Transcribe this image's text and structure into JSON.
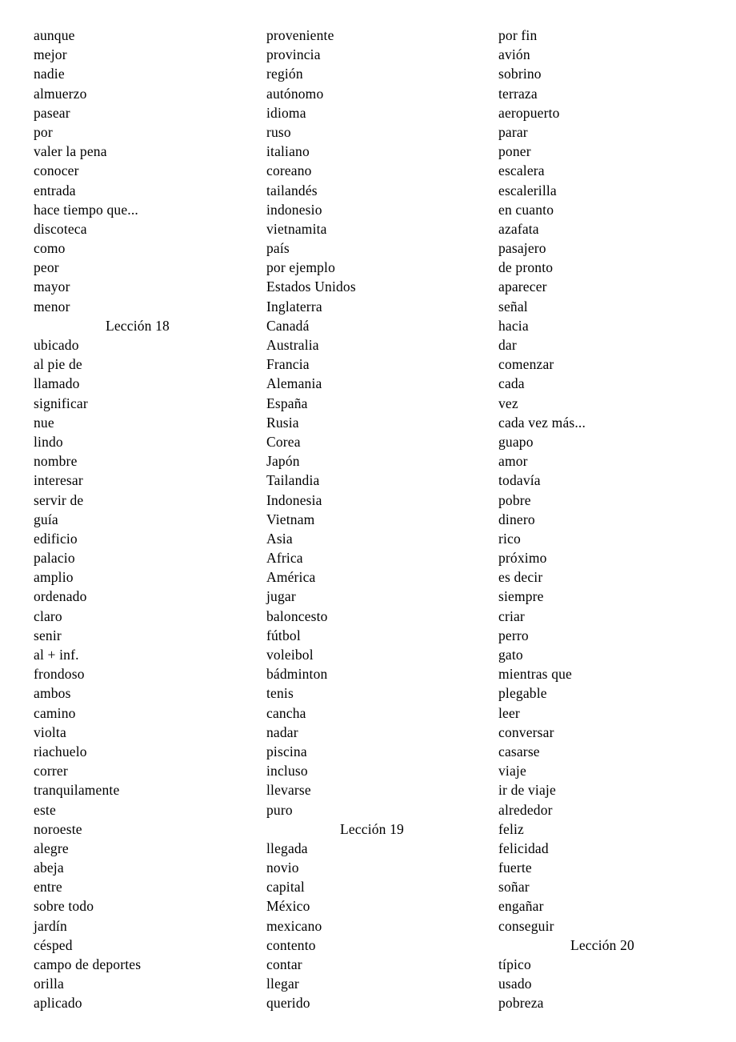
{
  "document": {
    "type": "vocabulary-word-list",
    "language": "Spanish",
    "columns": [
      {
        "id": "column-1",
        "lines": [
          {
            "kind": "entry",
            "text": "aunque"
          },
          {
            "kind": "entry",
            "text": "mejor"
          },
          {
            "kind": "entry",
            "text": "nadie"
          },
          {
            "kind": "entry",
            "text": "almuerzo"
          },
          {
            "kind": "entry",
            "text": "pasear"
          },
          {
            "kind": "entry",
            "text": "por"
          },
          {
            "kind": "entry",
            "text": "valer la pena"
          },
          {
            "kind": "entry",
            "text": "conocer"
          },
          {
            "kind": "entry",
            "text": "entrada"
          },
          {
            "kind": "entry",
            "text": "hace tiempo que..."
          },
          {
            "kind": "entry",
            "text": "discoteca"
          },
          {
            "kind": "entry",
            "text": "como"
          },
          {
            "kind": "entry",
            "text": "peor"
          },
          {
            "kind": "entry",
            "text": "mayor"
          },
          {
            "kind": "entry",
            "text": "menor"
          },
          {
            "kind": "heading",
            "text": "Lección 18"
          },
          {
            "kind": "entry",
            "text": "ubicado"
          },
          {
            "kind": "entry",
            "text": "al pie de"
          },
          {
            "kind": "entry",
            "text": "llamado"
          },
          {
            "kind": "entry",
            "text": "significar"
          },
          {
            "kind": "entry",
            "text": "nue"
          },
          {
            "kind": "entry",
            "text": "lindo"
          },
          {
            "kind": "entry",
            "text": "nombre"
          },
          {
            "kind": "entry",
            "text": "interesar"
          },
          {
            "kind": "entry",
            "text": "servir de"
          },
          {
            "kind": "entry",
            "text": "guía"
          },
          {
            "kind": "entry",
            "text": "edificio"
          },
          {
            "kind": "entry",
            "text": "palacio"
          },
          {
            "kind": "entry",
            "text": "amplio"
          },
          {
            "kind": "entry",
            "text": "ordenado"
          },
          {
            "kind": "entry",
            "text": "claro"
          },
          {
            "kind": "entry",
            "text": "senir"
          },
          {
            "kind": "entry",
            "text": "al + inf."
          },
          {
            "kind": "entry",
            "text": "frondoso"
          },
          {
            "kind": "entry",
            "text": "ambos"
          },
          {
            "kind": "entry",
            "text": "camino"
          },
          {
            "kind": "entry",
            "text": "violta"
          },
          {
            "kind": "entry",
            "text": "riachuelo"
          },
          {
            "kind": "entry",
            "text": "correr"
          },
          {
            "kind": "entry",
            "text": "tranquilamente"
          },
          {
            "kind": "entry",
            "text": "este"
          },
          {
            "kind": "entry",
            "text": "noroeste"
          },
          {
            "kind": "entry",
            "text": "alegre"
          },
          {
            "kind": "entry",
            "text": "abeja"
          },
          {
            "kind": "entry",
            "text": "entre"
          },
          {
            "kind": "entry",
            "text": "sobre todo"
          },
          {
            "kind": "entry",
            "text": "jardín"
          },
          {
            "kind": "entry",
            "text": "césped"
          },
          {
            "kind": "entry",
            "text": "campo de deportes"
          },
          {
            "kind": "entry",
            "text": "orilla"
          },
          {
            "kind": "entry",
            "text": "aplicado"
          }
        ]
      },
      {
        "id": "column-2",
        "lines": [
          {
            "kind": "entry",
            "text": "proveniente"
          },
          {
            "kind": "entry",
            "text": "provincia"
          },
          {
            "kind": "entry",
            "text": "región"
          },
          {
            "kind": "entry",
            "text": "autónomo"
          },
          {
            "kind": "entry",
            "text": "idioma"
          },
          {
            "kind": "entry",
            "text": "ruso"
          },
          {
            "kind": "entry",
            "text": "italiano"
          },
          {
            "kind": "entry",
            "text": "coreano"
          },
          {
            "kind": "entry",
            "text": "tailandés"
          },
          {
            "kind": "entry",
            "text": "indonesio"
          },
          {
            "kind": "entry",
            "text": "vietnamita"
          },
          {
            "kind": "entry",
            "text": "país"
          },
          {
            "kind": "entry",
            "text": "por ejemplo"
          },
          {
            "kind": "entry",
            "text": "Estados Unidos"
          },
          {
            "kind": "entry",
            "text": "Inglaterra"
          },
          {
            "kind": "entry",
            "text": "Canadá"
          },
          {
            "kind": "entry",
            "text": "Australia"
          },
          {
            "kind": "entry",
            "text": "Francia"
          },
          {
            "kind": "entry",
            "text": "Alemania"
          },
          {
            "kind": "entry",
            "text": "España"
          },
          {
            "kind": "entry",
            "text": "Rusia"
          },
          {
            "kind": "entry",
            "text": "Corea"
          },
          {
            "kind": "entry",
            "text": "Japón"
          },
          {
            "kind": "entry",
            "text": "Tailandia"
          },
          {
            "kind": "entry",
            "text": "Indonesia"
          },
          {
            "kind": "entry",
            "text": "Vietnam"
          },
          {
            "kind": "entry",
            "text": "Asia"
          },
          {
            "kind": "entry",
            "text": "Africa"
          },
          {
            "kind": "entry",
            "text": "América"
          },
          {
            "kind": "entry",
            "text": "jugar"
          },
          {
            "kind": "entry",
            "text": "baloncesto"
          },
          {
            "kind": "entry",
            "text": "fútbol"
          },
          {
            "kind": "entry",
            "text": "voleibol"
          },
          {
            "kind": "entry",
            "text": "bádminton"
          },
          {
            "kind": "entry",
            "text": "tenis"
          },
          {
            "kind": "entry",
            "text": "cancha"
          },
          {
            "kind": "entry",
            "text": "nadar"
          },
          {
            "kind": "entry",
            "text": "piscina"
          },
          {
            "kind": "entry",
            "text": "incluso"
          },
          {
            "kind": "entry",
            "text": "llevarse"
          },
          {
            "kind": "entry",
            "text": "puro"
          },
          {
            "kind": "heading",
            "text": "Lección 19"
          },
          {
            "kind": "entry",
            "text": "llegada"
          },
          {
            "kind": "entry",
            "text": "novio"
          },
          {
            "kind": "entry",
            "text": "capital"
          },
          {
            "kind": "entry",
            "text": "México"
          },
          {
            "kind": "entry",
            "text": "mexicano"
          },
          {
            "kind": "entry",
            "text": "contento"
          },
          {
            "kind": "entry",
            "text": "contar"
          },
          {
            "kind": "entry",
            "text": "llegar"
          },
          {
            "kind": "entry",
            "text": "querido"
          }
        ]
      },
      {
        "id": "column-3",
        "lines": [
          {
            "kind": "entry",
            "text": "por fin"
          },
          {
            "kind": "entry",
            "text": "avión"
          },
          {
            "kind": "entry",
            "text": "sobrino"
          },
          {
            "kind": "entry",
            "text": "terraza"
          },
          {
            "kind": "entry",
            "text": "aeropuerto"
          },
          {
            "kind": "entry",
            "text": "parar"
          },
          {
            "kind": "entry",
            "text": "poner"
          },
          {
            "kind": "entry",
            "text": "escalera"
          },
          {
            "kind": "entry",
            "text": "escalerilla"
          },
          {
            "kind": "entry",
            "text": "en cuanto"
          },
          {
            "kind": "entry",
            "text": "azafata"
          },
          {
            "kind": "entry",
            "text": "pasajero"
          },
          {
            "kind": "entry",
            "text": "de pronto"
          },
          {
            "kind": "entry",
            "text": "aparecer"
          },
          {
            "kind": "entry",
            "text": "señal"
          },
          {
            "kind": "entry",
            "text": "hacia"
          },
          {
            "kind": "entry",
            "text": "dar"
          },
          {
            "kind": "entry",
            "text": "comenzar"
          },
          {
            "kind": "entry",
            "text": "cada"
          },
          {
            "kind": "entry",
            "text": "vez"
          },
          {
            "kind": "entry",
            "text": "cada vez más..."
          },
          {
            "kind": "entry",
            "text": "guapo"
          },
          {
            "kind": "entry",
            "text": "amor"
          },
          {
            "kind": "entry",
            "text": "todavía"
          },
          {
            "kind": "entry",
            "text": "pobre"
          },
          {
            "kind": "entry",
            "text": "dinero"
          },
          {
            "kind": "entry",
            "text": "rico"
          },
          {
            "kind": "entry",
            "text": "próximo"
          },
          {
            "kind": "entry",
            "text": "es decir"
          },
          {
            "kind": "entry",
            "text": "siempre"
          },
          {
            "kind": "entry",
            "text": "criar"
          },
          {
            "kind": "entry",
            "text": "perro"
          },
          {
            "kind": "entry",
            "text": "gato"
          },
          {
            "kind": "entry",
            "text": "mientras que"
          },
          {
            "kind": "entry",
            "text": "plegable"
          },
          {
            "kind": "entry",
            "text": "leer"
          },
          {
            "kind": "entry",
            "text": "conversar"
          },
          {
            "kind": "entry",
            "text": "casarse"
          },
          {
            "kind": "entry",
            "text": "viaje"
          },
          {
            "kind": "entry",
            "text": "ir de viaje"
          },
          {
            "kind": "entry",
            "text": "alrededor"
          },
          {
            "kind": "entry",
            "text": "feliz"
          },
          {
            "kind": "entry",
            "text": "felicidad"
          },
          {
            "kind": "entry",
            "text": "fuerte"
          },
          {
            "kind": "entry",
            "text": "soñar"
          },
          {
            "kind": "entry",
            "text": "engañar"
          },
          {
            "kind": "entry",
            "text": "conseguir"
          },
          {
            "kind": "heading",
            "text": "Lección 20"
          },
          {
            "kind": "entry",
            "text": "típico"
          },
          {
            "kind": "entry",
            "text": "usado"
          },
          {
            "kind": "entry",
            "text": "pobreza"
          }
        ]
      }
    ]
  }
}
